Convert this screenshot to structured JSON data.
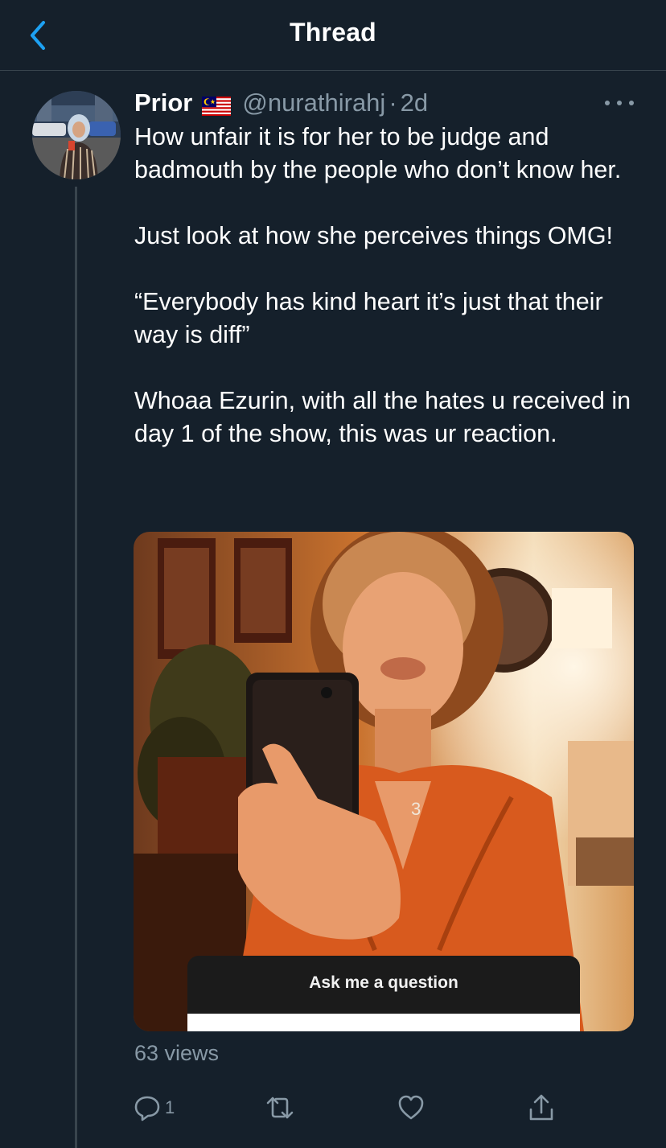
{
  "header": {
    "title": "Thread"
  },
  "tweet": {
    "author_name": "Prior",
    "handle": "@nurathirahj",
    "separator": "·",
    "time": "2d",
    "paragraphs": [
      "How unfair it is for her to be judge and badmouth by the people who don’t know her.",
      "Just look at how she perceives things OMG!",
      "“Everybody has kind heart it’s just that their way is diff”",
      "Whoaa Ezurin, with all the hates u received in day 1 of the show, this was ur reaction."
    ],
    "media": {
      "overlay_text": "Ask me a question"
    },
    "views": "63 views",
    "actions": {
      "reply_count": "1"
    }
  },
  "icons": {
    "back": "chevron-left-icon",
    "flag": "malaysia-flag-icon",
    "more": "more-horizontal-icon",
    "reply": "reply-icon",
    "retweet": "retweet-icon",
    "like": "heart-icon",
    "share": "share-icon"
  },
  "colors": {
    "background": "#15202b",
    "accent": "#1da1f2",
    "secondary_text": "#8899a6",
    "divider": "#38444d"
  }
}
